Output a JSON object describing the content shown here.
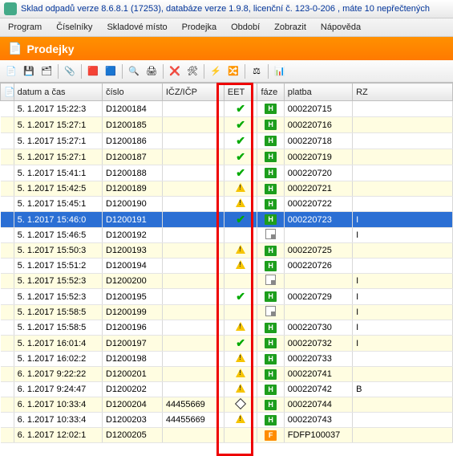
{
  "title": "Sklad odpadů verze 8.6.8.1 (17253), databáze verze 1.9.8, licenční č. 123-0-206 , máte 10 nepřečtených",
  "menu": [
    "Program",
    "Číselníky",
    "Skladové místo",
    "Prodejka",
    "Období",
    "Zobrazit",
    "Nápověda"
  ],
  "header": "Prodejky",
  "cols": {
    "row": "",
    "date": "datum a čas",
    "cislo": "číslo",
    "icz": "IČZ/IČP",
    "eet": "EET",
    "faze": "fáze",
    "platba": "platba",
    "rz": "RZ"
  },
  "rows": [
    {
      "date": "5. 1.2017 15:22:3",
      "cislo": "D1200184",
      "icz": "",
      "eet": "check",
      "faze": "h",
      "platba": "000220715",
      "rz": "",
      "alt": 0,
      "sel": 0
    },
    {
      "date": "5. 1.2017 15:27:1",
      "cislo": "D1200185",
      "icz": "",
      "eet": "check",
      "faze": "h",
      "platba": "000220716",
      "rz": "",
      "alt": 1,
      "sel": 0
    },
    {
      "date": "5. 1.2017 15:27:1",
      "cislo": "D1200186",
      "icz": "",
      "eet": "check",
      "faze": "h",
      "platba": "000220718",
      "rz": "",
      "alt": 0,
      "sel": 0
    },
    {
      "date": "5. 1.2017 15:27:1",
      "cislo": "D1200187",
      "icz": "",
      "eet": "check",
      "faze": "h",
      "platba": "000220719",
      "rz": "",
      "alt": 1,
      "sel": 0
    },
    {
      "date": "5. 1.2017 15:41:1",
      "cislo": "D1200188",
      "icz": "",
      "eet": "check",
      "faze": "h",
      "platba": "000220720",
      "rz": "",
      "alt": 0,
      "sel": 0
    },
    {
      "date": "5. 1.2017 15:42:5",
      "cislo": "D1200189",
      "icz": "",
      "eet": "warn",
      "faze": "h",
      "platba": "000220721",
      "rz": "",
      "alt": 1,
      "sel": 0
    },
    {
      "date": "5. 1.2017 15:45:1",
      "cislo": "D1200190",
      "icz": "",
      "eet": "warn",
      "faze": "h",
      "platba": "000220722",
      "rz": "",
      "alt": 0,
      "sel": 0
    },
    {
      "date": "5. 1.2017 15:46:0",
      "cislo": "D1200191",
      "icz": "",
      "eet": "check",
      "faze": "h",
      "platba": "000220723",
      "rz": "I",
      "alt": 1,
      "sel": 1
    },
    {
      "date": "5. 1.2017 15:46:5",
      "cislo": "D1200192",
      "icz": "",
      "eet": "",
      "faze": "doc",
      "platba": "",
      "rz": "I",
      "alt": 0,
      "sel": 0
    },
    {
      "date": "5. 1.2017 15:50:3",
      "cislo": "D1200193",
      "icz": "",
      "eet": "warn",
      "faze": "h",
      "platba": "000220725",
      "rz": "",
      "alt": 1,
      "sel": 0
    },
    {
      "date": "5. 1.2017 15:51:2",
      "cislo": "D1200194",
      "icz": "",
      "eet": "warn",
      "faze": "h",
      "platba": "000220726",
      "rz": "",
      "alt": 0,
      "sel": 0
    },
    {
      "date": "5. 1.2017 15:52:3",
      "cislo": "D1200200",
      "icz": "",
      "eet": "",
      "faze": "doc",
      "platba": "",
      "rz": "I",
      "alt": 1,
      "sel": 0
    },
    {
      "date": "5. 1.2017 15:52:3",
      "cislo": "D1200195",
      "icz": "",
      "eet": "check",
      "faze": "h",
      "platba": "000220729",
      "rz": "I",
      "alt": 0,
      "sel": 0
    },
    {
      "date": "5. 1.2017 15:58:5",
      "cislo": "D1200199",
      "icz": "",
      "eet": "",
      "faze": "doc",
      "platba": "",
      "rz": "I",
      "alt": 1,
      "sel": 0
    },
    {
      "date": "5. 1.2017 15:58:5",
      "cislo": "D1200196",
      "icz": "",
      "eet": "warn",
      "faze": "h",
      "platba": "000220730",
      "rz": "I",
      "alt": 0,
      "sel": 0
    },
    {
      "date": "5. 1.2017 16:01:4",
      "cislo": "D1200197",
      "icz": "",
      "eet": "check",
      "faze": "h",
      "platba": "000220732",
      "rz": "I",
      "alt": 1,
      "sel": 0
    },
    {
      "date": "5. 1.2017 16:02:2",
      "cislo": "D1200198",
      "icz": "",
      "eet": "warn",
      "faze": "h",
      "platba": "000220733",
      "rz": "",
      "alt": 0,
      "sel": 0
    },
    {
      "date": "6. 1.2017 9:22:22",
      "cislo": "D1200201",
      "icz": "",
      "eet": "warn",
      "faze": "h",
      "platba": "000220741",
      "rz": "",
      "alt": 1,
      "sel": 0
    },
    {
      "date": "6. 1.2017 9:24:47",
      "cislo": "D1200202",
      "icz": "",
      "eet": "warn",
      "faze": "h",
      "platba": "000220742",
      "rz": "B",
      "alt": 0,
      "sel": 0
    },
    {
      "date": "6. 1.2017 10:33:4",
      "cislo": "D1200204",
      "icz": "44455669",
      "eet": "diamond",
      "faze": "h",
      "platba": "000220744",
      "rz": "",
      "alt": 1,
      "sel": 0
    },
    {
      "date": "6. 1.2017 10:33:4",
      "cislo": "D1200203",
      "icz": "44455669",
      "eet": "warn",
      "faze": "h",
      "platba": "000220743",
      "rz": "",
      "alt": 0,
      "sel": 0
    },
    {
      "date": "6. 1.2017 12:02:1",
      "cislo": "D1200205",
      "icz": "",
      "eet": "",
      "faze": "f",
      "platba": "FDFP100037",
      "rz": "",
      "alt": 1,
      "sel": 0
    }
  ]
}
